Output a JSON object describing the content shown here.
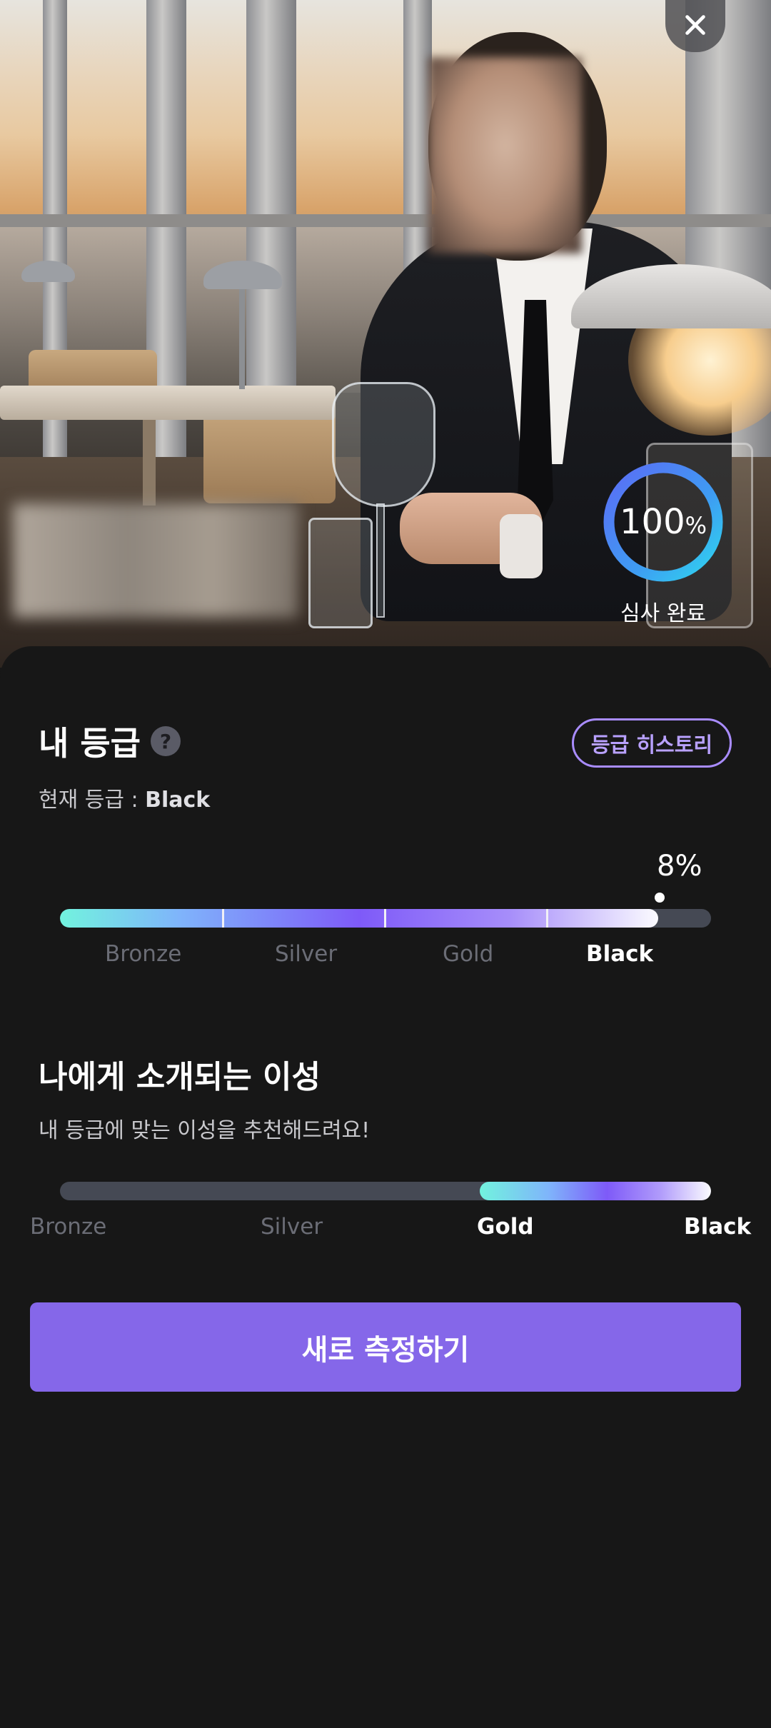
{
  "photo": {
    "caption": "심사 완료",
    "progress_value": "100",
    "progress_unit": "%"
  },
  "close_icon": "close-icon",
  "grade": {
    "title": "내 등급",
    "help_icon": "?",
    "history_button": "등급 히스토리",
    "current_label": "현재 등급 : ",
    "current_value": "Black",
    "percent": "8%",
    "tiers": [
      "Bronze",
      "Silver",
      "Gold",
      "Black"
    ],
    "active_tier": "Black"
  },
  "match": {
    "title": "나에게 소개되는 이성",
    "subtitle": "내 등급에 맞는 이성을 추천해드려요!",
    "tiers": [
      "Bronze",
      "Silver",
      "Gold",
      "Black"
    ],
    "active_tiers": [
      "Gold",
      "Black"
    ]
  },
  "cta": {
    "label": "새로 측정하기"
  },
  "colors": {
    "accent": "#8567e9",
    "outline": "#a98cff",
    "ring_start": "#4e7cf6",
    "ring_end": "#34d4f0"
  }
}
